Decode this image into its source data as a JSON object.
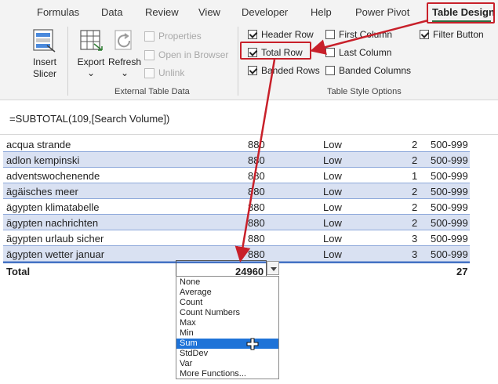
{
  "tabs": [
    {
      "label": "Formulas"
    },
    {
      "label": "Data"
    },
    {
      "label": "Review"
    },
    {
      "label": "View"
    },
    {
      "label": "Developer"
    },
    {
      "label": "Help"
    },
    {
      "label": "Power Pivot"
    },
    {
      "label": "Table Design"
    }
  ],
  "ribbon": {
    "insert_slicer": {
      "line1": "Insert",
      "line2": "Slicer"
    },
    "export": {
      "label": "Export",
      "arrow": "⌄"
    },
    "refresh": {
      "label": "Refresh",
      "arrow": "⌄"
    },
    "properties": "Properties",
    "open_in_browser": "Open in Browser",
    "unlink": "Unlink",
    "external_group_label": "External Table Data",
    "style_options_label": "Table Style Options",
    "options": {
      "header_row": {
        "label": "Header Row",
        "checked": true
      },
      "total_row": {
        "label": "Total Row",
        "checked": true
      },
      "banded_rows": {
        "label": "Banded Rows",
        "checked": true
      },
      "first_column": {
        "label": "First Column",
        "checked": false
      },
      "last_column": {
        "label": "Last Column",
        "checked": false
      },
      "banded_columns": {
        "label": "Banded Columns",
        "checked": false
      },
      "filter_button": {
        "label": "Filter Button",
        "checked": true
      }
    }
  },
  "formula_bar": {
    "formula": "=SUBTOTAL(109,[Search Volume])"
  },
  "table": {
    "rows": [
      {
        "keyword": "acqua strande",
        "volume": "880",
        "competition": "Low",
        "count": "2",
        "range": "500-999"
      },
      {
        "keyword": "adlon kempinski",
        "volume": "880",
        "competition": "Low",
        "count": "2",
        "range": "500-999"
      },
      {
        "keyword": "adventswochenende",
        "volume": "880",
        "competition": "Low",
        "count": "1",
        "range": "500-999"
      },
      {
        "keyword": "ägäisches meer",
        "volume": "880",
        "competition": "Low",
        "count": "2",
        "range": "500-999"
      },
      {
        "keyword": "ägypten klimatabelle",
        "volume": "880",
        "competition": "Low",
        "count": "2",
        "range": "500-999"
      },
      {
        "keyword": "ägypten nachrichten",
        "volume": "880",
        "competition": "Low",
        "count": "2",
        "range": "500-999"
      },
      {
        "keyword": "ägypten urlaub sicher",
        "volume": "880",
        "competition": "Low",
        "count": "3",
        "range": "500-999"
      },
      {
        "keyword": "ägypten wetter januar",
        "volume": "880",
        "competition": "Low",
        "count": "3",
        "range": "500-999"
      }
    ],
    "total": {
      "label": "Total",
      "volume_total": "24960",
      "count_total": "27"
    }
  },
  "dropdown": {
    "options": [
      "None",
      "Average",
      "Count",
      "Count Numbers",
      "Max",
      "Min",
      "Sum",
      "StdDev",
      "Var",
      "More Functions..."
    ],
    "selected": "Sum"
  },
  "colors": {
    "annotation_red": "#c8202a",
    "band_blue": "#d9e1f2",
    "selection_blue": "#1e73d8",
    "table_border": "#4472c4"
  }
}
